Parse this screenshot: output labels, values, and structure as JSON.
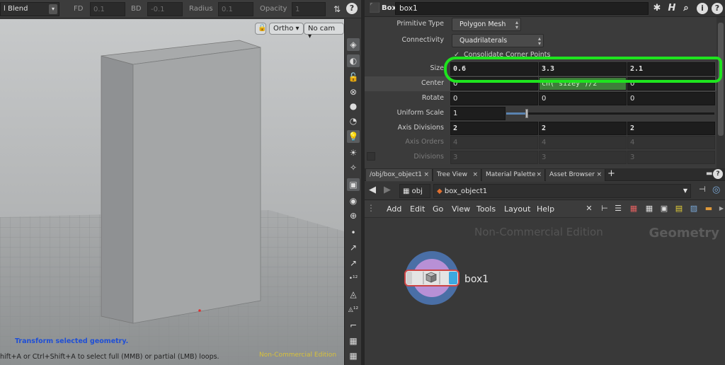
{
  "viewport_toolbar": {
    "blend_menu": "l Blend",
    "fd_label": "FD",
    "fd_value": "0.1",
    "bd_label": "BD",
    "bd_value": "-0.1",
    "radius_label": "Radius",
    "radius_value": "0.1",
    "opacity_label": "Opacity",
    "opacity_value": "1"
  },
  "viewport": {
    "projection_menu": "Ortho",
    "camera_menu": "No cam",
    "status_title": "Transform selected geometry.",
    "status_hint": "hift+A or Ctrl+Shift+A to select full (MMB) or partial (LMB) loops.",
    "watermark": "Non-Commercial Edition"
  },
  "params": {
    "node_type": "Box",
    "node_name": "box1",
    "rows": {
      "primitive_type": {
        "label": "Primitive Type",
        "value": "Polygon Mesh"
      },
      "connectivity": {
        "label": "Connectivity",
        "value": "Quadrilaterals"
      },
      "consolidate": {
        "label": "Consolidate Corner Points"
      },
      "size": {
        "label": "Size",
        "x": "0.6",
        "y": "3.3",
        "z": "2.1"
      },
      "center": {
        "label": "Center",
        "x": "0",
        "y": "ch(\"sizey\")/2",
        "z": "0"
      },
      "rotate": {
        "label": "Rotate",
        "x": "0",
        "y": "0",
        "z": "0"
      },
      "uniform_scale": {
        "label": "Uniform Scale",
        "value": "1",
        "level": 0.1
      },
      "axis_divisions": {
        "label": "Axis Divisions",
        "x": "2",
        "y": "2",
        "z": "2"
      },
      "axis_orders": {
        "label": "Axis Orders",
        "x": "4",
        "y": "4",
        "z": "4"
      },
      "divisions": {
        "label": "Divisions",
        "x": "3",
        "y": "3",
        "z": "3"
      }
    }
  },
  "network": {
    "tabs": [
      "/obj/box_object1",
      "Tree View",
      "Material Palette",
      "Asset Browser"
    ],
    "path": {
      "root": "obj",
      "object": "box_object1"
    },
    "menu": [
      "Add",
      "Edit",
      "Go",
      "View",
      "Tools",
      "Layout",
      "Help"
    ],
    "watermark": "Non-Commercial Edition",
    "context_label": "Geometry",
    "node_label": "box1"
  },
  "colors": {
    "highlight_circle": "#1ee41e",
    "status_title": "#1f4fd6",
    "watermark_viewport": "#d8c13a",
    "expression_field": "#3e7e3a"
  }
}
